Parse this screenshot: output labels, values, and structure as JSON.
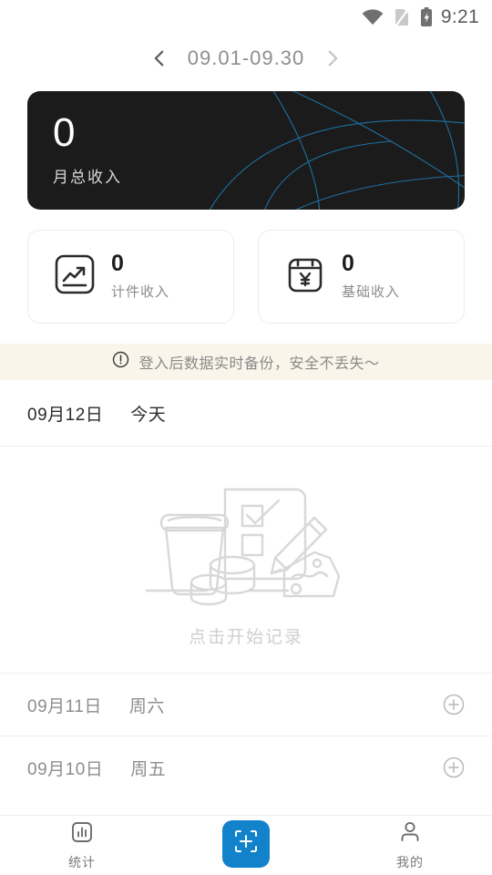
{
  "status_bar": {
    "time": "9:21",
    "icons": [
      "wifi-icon",
      "sim-card-off-icon",
      "battery-charging-icon"
    ]
  },
  "header": {
    "prev_icon": "chevron-left-icon",
    "next_icon": "chevron-right-icon",
    "date_range": "09.01-09.30"
  },
  "hero": {
    "amount": "0",
    "label": "月总收入",
    "background_color": "#1b1b1b",
    "accent_color": "#1f6fa0"
  },
  "stats": [
    {
      "icon": "trending-chart-icon",
      "value": "0",
      "label": "计件收入"
    },
    {
      "icon": "calendar-yen-icon",
      "value": "0",
      "label": "基础收入"
    }
  ],
  "notice": {
    "icon": "exclamation-circle-icon",
    "text": "登入后数据实时备份，安全不丢失～",
    "background_color": "#faf5ea"
  },
  "today": {
    "date": "09月12日",
    "weekday": "今天",
    "empty_illustration": "coffee-checklist-coins-illustration",
    "empty_text": "点击开始记录"
  },
  "day_rows": [
    {
      "date": "09月11日",
      "weekday": "周六",
      "add_icon": "plus-circle-icon"
    },
    {
      "date": "09月10日",
      "weekday": "周五",
      "add_icon": "plus-circle-icon"
    }
  ],
  "tabbar": {
    "left": {
      "icon": "bar-chart-icon",
      "label": "统计"
    },
    "center": {
      "icon": "add-record-icon",
      "color": "#1282cb"
    },
    "right": {
      "icon": "person-icon",
      "label": "我的"
    }
  }
}
